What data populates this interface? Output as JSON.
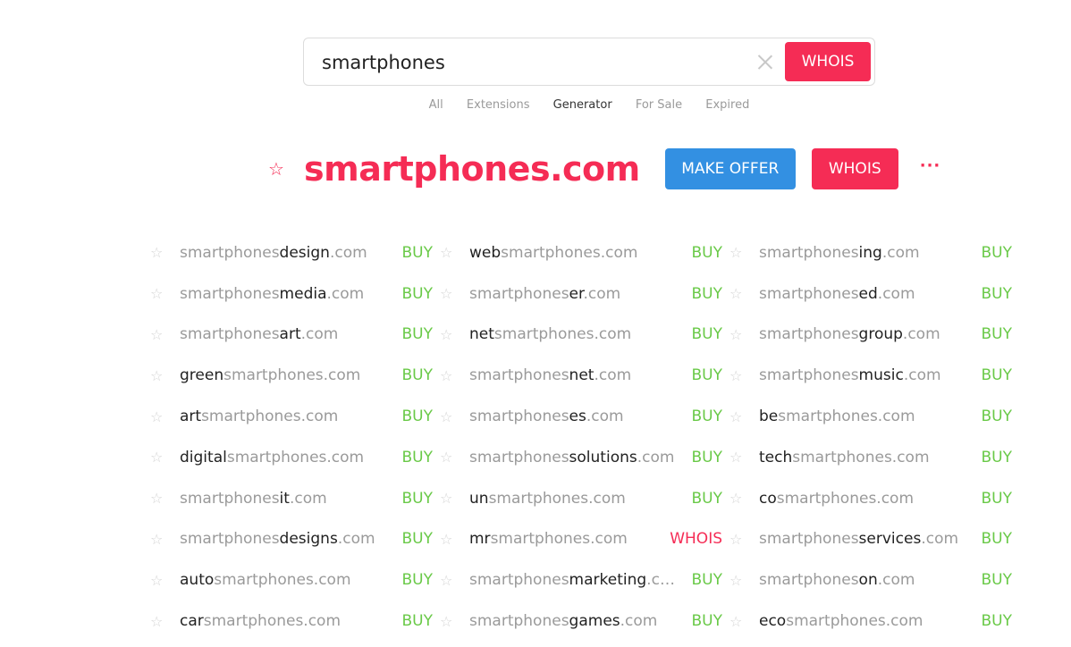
{
  "search": {
    "value": "smartphones",
    "placeholder": "",
    "button_label": "WHOIS"
  },
  "tabs": [
    {
      "label": "All",
      "active": false
    },
    {
      "label": "Extensions",
      "active": false
    },
    {
      "label": "Generator",
      "active": true
    },
    {
      "label": "For Sale",
      "active": false
    },
    {
      "label": "Expired",
      "active": false
    }
  ],
  "main": {
    "domain": "smartphones.com",
    "star_icon": "☆",
    "make_offer_label": "MAKE OFFER",
    "whois_label": "WHOIS",
    "more_label": "···"
  },
  "colors": {
    "accent": "#f52c55",
    "offer": "#3390e2",
    "buy": "#69c947"
  },
  "results": [
    {
      "prefix": "",
      "kw": "design",
      "suffix": "",
      "base": "smartphones",
      "tld": ".com",
      "pos": "after",
      "action": "BUY"
    },
    {
      "kw": "web",
      "pos": "before",
      "tld": ".com",
      "action": "BUY"
    },
    {
      "kw": "ing",
      "pos": "after",
      "tld": ".com",
      "action": "BUY"
    },
    {
      "kw": "media",
      "pos": "after",
      "tld": ".com",
      "action": "BUY"
    },
    {
      "kw": "er",
      "pos": "after",
      "tld": ".com",
      "action": "BUY"
    },
    {
      "kw": "ed",
      "pos": "after",
      "tld": ".com",
      "action": "BUY"
    },
    {
      "kw": "art",
      "pos": "after",
      "tld": ".com",
      "action": "BUY"
    },
    {
      "kw": "net",
      "pos": "before",
      "tld": ".com",
      "action": "BUY"
    },
    {
      "kw": "group",
      "pos": "after",
      "tld": ".com",
      "action": "BUY"
    },
    {
      "kw": "green",
      "pos": "before",
      "tld": ".com",
      "action": "BUY"
    },
    {
      "kw": "net",
      "pos": "after",
      "tld": ".com",
      "action": "BUY"
    },
    {
      "kw": "music",
      "pos": "after",
      "tld": ".com",
      "action": "BUY"
    },
    {
      "kw": "art",
      "pos": "before",
      "tld": ".com",
      "action": "BUY"
    },
    {
      "kw": "es",
      "pos": "after",
      "tld": ".com",
      "action": "BUY"
    },
    {
      "kw": "be",
      "pos": "before",
      "tld": ".com",
      "action": "BUY"
    },
    {
      "kw": "digital",
      "pos": "before",
      "tld": ".com",
      "action": "BUY"
    },
    {
      "kw": "solutions",
      "pos": "after",
      "tld": ".com",
      "action": "BUY"
    },
    {
      "kw": "tech",
      "pos": "before",
      "tld": ".com",
      "action": "BUY"
    },
    {
      "kw": "it",
      "pos": "after",
      "tld": ".com",
      "action": "BUY"
    },
    {
      "kw": "un",
      "pos": "before",
      "tld": ".com",
      "action": "BUY"
    },
    {
      "kw": "co",
      "pos": "before",
      "tld": ".com",
      "action": "BUY"
    },
    {
      "kw": "designs",
      "pos": "after",
      "tld": ".com",
      "action": "BUY"
    },
    {
      "kw": "mr",
      "pos": "before",
      "tld": ".com",
      "action": "WHOIS"
    },
    {
      "kw": "services",
      "pos": "after",
      "tld": ".com",
      "action": "BUY"
    },
    {
      "kw": "auto",
      "pos": "before",
      "tld": ".com",
      "action": "BUY"
    },
    {
      "kw": "marketing",
      "pos": "after",
      "tld": ".com",
      "action": "BUY"
    },
    {
      "kw": "on",
      "pos": "after",
      "tld": ".com",
      "action": "BUY"
    },
    {
      "kw": "car",
      "pos": "before",
      "tld": ".com",
      "action": "BUY"
    },
    {
      "kw": "games",
      "pos": "after",
      "tld": ".com",
      "action": "BUY"
    },
    {
      "kw": "eco",
      "pos": "before",
      "tld": ".com",
      "action": "BUY"
    }
  ],
  "base_keyword": "smartphones",
  "item_star_icon": "☆"
}
